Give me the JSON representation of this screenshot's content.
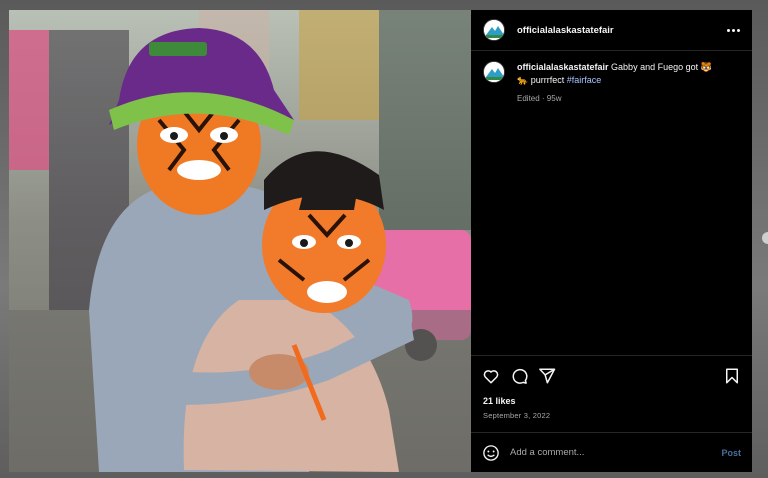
{
  "post": {
    "username": "officialalaskastatefair",
    "caption_user": "officialalaskastatefair",
    "caption_text_1": " Gabby and Fuego got ",
    "caption_emoji_1": "🐯",
    "caption_emoji_2": "🐆",
    "caption_text_2": " purrrfect ",
    "hashtag": "#fairface",
    "edited_meta": "Edited · 95w",
    "likes": "21 likes",
    "date": "September 3, 2022",
    "comment_placeholder": "Add a comment...",
    "post_label": "Post"
  },
  "icons": {
    "more": "more-options-icon",
    "like": "heart-icon",
    "comment": "comment-icon",
    "share": "share-icon",
    "save": "bookmark-icon",
    "emoji": "emoji-icon"
  },
  "colors": {
    "background": "#000000",
    "text": "#f5f5f5",
    "muted": "#a8a8a8",
    "hashtag": "#a9c5ff",
    "post_button": "#4a6e9b",
    "divider": "#262626"
  }
}
